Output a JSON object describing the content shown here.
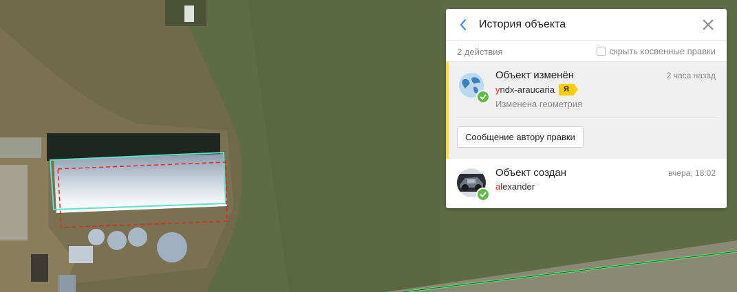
{
  "panel": {
    "title": "История объекта",
    "actions_count": "2 действия",
    "hide_indirect_label": "скрыть косвенные правки",
    "hide_indirect_checked": false
  },
  "entries": [
    {
      "title": "Объект изменён",
      "time": "2 часа назад",
      "user_first": "y",
      "user_rest": "ndx-araucaria",
      "user_badge": "Я",
      "description": "Изменена геометрия",
      "message_button": "Сообщение автору правки",
      "avatar": "globe-avatar",
      "status": "approved"
    },
    {
      "title": "Объект создан",
      "time": "вчера, 18:02",
      "user_first": "a",
      "user_rest": "lexander",
      "avatar": "car-avatar",
      "status": "approved"
    }
  ],
  "colors": {
    "accent_yellow": "#ffdb4d",
    "check_green": "#5fba48",
    "username_red": "#e0281f",
    "geometry_new": "#5fe0c8",
    "geometry_old": "#e0281f",
    "road_line": "#5fe07a"
  },
  "icons": [
    "back-arrow-icon",
    "close-icon",
    "checkmark-icon",
    "yandex-badge-icon"
  ]
}
